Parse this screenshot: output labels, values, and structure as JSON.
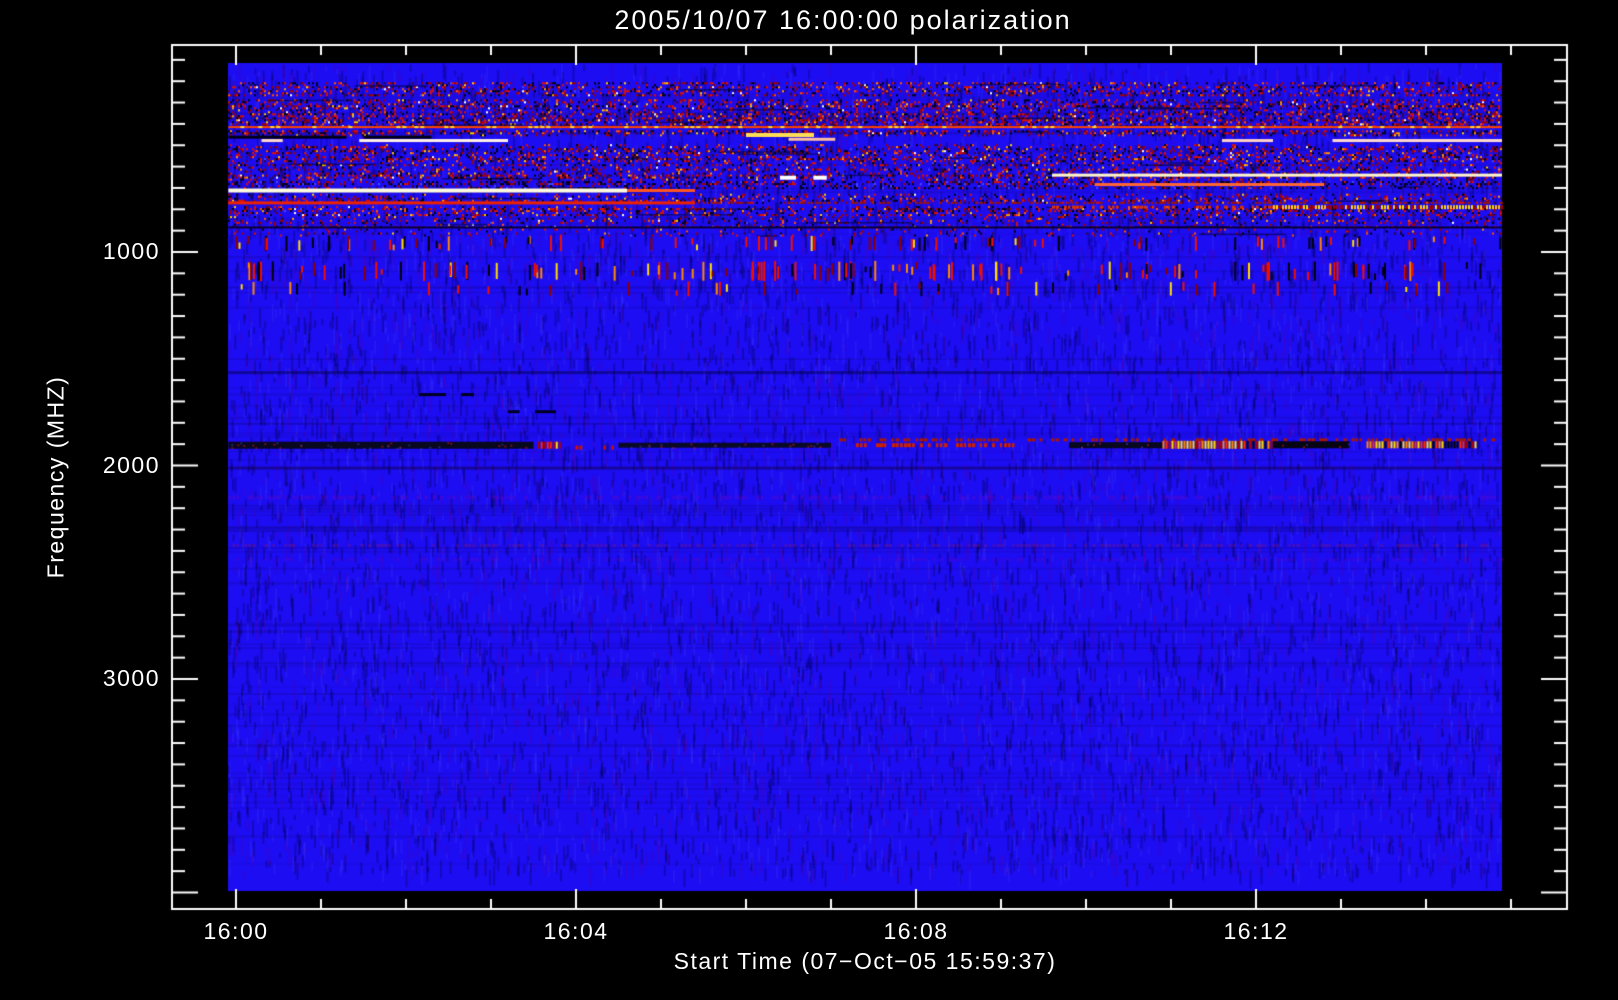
{
  "window": {
    "background": "#000000",
    "axis_color": "#ffffff"
  },
  "chart_data": {
    "type": "heatmap",
    "subtype": "radio-spectrogram",
    "title": "2005/10/07 16:00:00 polarization",
    "xlabel": "Start Time (07−Oct−05 15:59:37)",
    "ylabel": "Frequency (MHZ)",
    "legend": "none",
    "grid": "off",
    "x_axis": {
      "tick_labels": [
        "16:00",
        "16:04",
        "16:08",
        "16:12"
      ],
      "tick_minutes": [
        0,
        4,
        8,
        12
      ],
      "minor_step_min": 1,
      "axis_range_min": [
        -0.75,
        15.66
      ],
      "data_range_min": [
        -0.09,
        14.9
      ]
    },
    "y_axis": {
      "tick_labels": [
        "1000",
        "2000",
        "3000"
      ],
      "tick_mhz": [
        1000,
        2000,
        3000
      ],
      "minor_step_mhz": 100,
      "axis_range_mhz": [
        30,
        4080
      ],
      "data_range_mhz": [
        115,
        3995
      ],
      "direction": "increasing-downward"
    },
    "colors": {
      "base": "#1d0df2",
      "axis": "#ffffff",
      "speckle": [
        "#a00000",
        "#e01000",
        "#000018",
        "#2e083a",
        "#ff5500",
        "#5a0030",
        "#ff9900",
        "#ffd000",
        "#ffffff",
        "#4545ff"
      ],
      "rfi": [
        "#ee1100",
        "#8a0000",
        "#000010",
        "#ffdd00",
        "#ff8800"
      ]
    },
    "noise_bands": [
      {
        "f0": 205,
        "f1": 265,
        "d": 0.4,
        "dark": false
      },
      {
        "f0": 285,
        "f1": 410,
        "d": 0.5,
        "dark": false
      },
      {
        "f0": 430,
        "f1": 458,
        "d": 0.45,
        "dark": false
      },
      {
        "f0": 495,
        "f1": 595,
        "d": 0.4,
        "dark": false
      },
      {
        "f0": 600,
        "f1": 662,
        "d": 0.45,
        "dark": false
      },
      {
        "f0": 668,
        "f1": 700,
        "d": 0.45,
        "dark": true
      },
      {
        "f0": 727,
        "f1": 770,
        "d": 0.3,
        "dark": false
      },
      {
        "f0": 785,
        "f1": 835,
        "d": 0.4,
        "dark": false
      },
      {
        "f0": 840,
        "f1": 885,
        "d": 0.2,
        "dark": false
      },
      {
        "f0": 890,
        "f1": 925,
        "d": 0.1,
        "dark": false
      }
    ],
    "rfi_bands": [
      {
        "f0": 925,
        "f1": 995,
        "d": 0.3
      },
      {
        "f0": 1045,
        "f1": 1135,
        "d": 0.45
      },
      {
        "f0": 1140,
        "f1": 1205,
        "d": 0.15
      }
    ],
    "line_features": [
      {
        "f": 415,
        "t0": -0.09,
        "t1": 14.9,
        "c": "#ff4400",
        "h": 2,
        "s": "hotline"
      },
      {
        "f": 462,
        "t0": -0.09,
        "t1": 1.3,
        "c": "#000014",
        "h": 3,
        "s": "solid"
      },
      {
        "f": 462,
        "t0": 1.5,
        "t1": 2.3,
        "c": "#000014",
        "h": 3,
        "s": "solid"
      },
      {
        "f": 478,
        "t0": 0.3,
        "t1": 0.55,
        "c": "#ffd8c8",
        "h": 3,
        "s": "solid"
      },
      {
        "f": 478,
        "t0": 1.45,
        "t1": 3.2,
        "c": "#fff0e6",
        "h": 3,
        "s": "solid"
      },
      {
        "f": 452,
        "t0": 6.0,
        "t1": 6.8,
        "c": "#ffdd55",
        "h": 4,
        "s": "solid"
      },
      {
        "f": 472,
        "t0": 6.5,
        "t1": 7.05,
        "c": "#ffc0a0",
        "h": 3,
        "s": "solid"
      },
      {
        "f": 478,
        "t0": 11.6,
        "t1": 12.2,
        "c": "#ffd0c4",
        "h": 3,
        "s": "solid"
      },
      {
        "f": 478,
        "t0": 12.9,
        "t1": 14.9,
        "c": "#ffd8cc",
        "h": 3,
        "s": "solid"
      },
      {
        "f": 652,
        "t0": 6.4,
        "t1": 6.95,
        "c": "#ffffff",
        "h": 4,
        "s": "dashes"
      },
      {
        "f": 712,
        "t0": -0.09,
        "t1": 4.6,
        "c": "#fffbdd",
        "h": 4,
        "s": "solid"
      },
      {
        "f": 712,
        "t0": 4.6,
        "t1": 5.4,
        "c": "#ff5522",
        "h": 3,
        "s": "solid"
      },
      {
        "f": 640,
        "t0": 9.6,
        "t1": 14.9,
        "c": "#fff6cc",
        "h": 3,
        "s": "solid"
      },
      {
        "f": 684,
        "t0": 10.1,
        "t1": 12.8,
        "c": "#ff6633",
        "h": 3,
        "s": "solid"
      },
      {
        "f": 770,
        "t0": -0.09,
        "t1": 5.4,
        "c": "#ee2200",
        "h": 3,
        "s": "solid"
      },
      {
        "f": 770,
        "t0": 5.4,
        "t1": 14.9,
        "c": "#99150a",
        "h": 2,
        "s": "dotted"
      },
      {
        "f": 790,
        "t0": 9.6,
        "t1": 12.2,
        "c": "#dd3300",
        "h": 3,
        "s": "dotted"
      },
      {
        "f": 790,
        "t0": 12.2,
        "t1": 14.9,
        "c": "#ffbb33",
        "h": 4,
        "s": "stripes"
      },
      {
        "f": 885,
        "t0": -0.09,
        "t1": 14.9,
        "c": "#0d0030",
        "h": 2,
        "s": "solid"
      },
      {
        "f": 1565,
        "t0": -0.09,
        "t1": 14.9,
        "c": "rgba(0,0,50,0.45)",
        "h": 3,
        "s": "solid"
      },
      {
        "f": 1668,
        "t0": 2.15,
        "t1": 2.8,
        "c": "#000020",
        "h": 3,
        "s": "dashes"
      },
      {
        "f": 1748,
        "t0": 3.2,
        "t1": 3.85,
        "c": "#000020",
        "h": 3,
        "s": "dashes"
      },
      {
        "f": 1880,
        "t0": 7.1,
        "t1": 14.9,
        "c": "#aa1700",
        "h": 3,
        "s": "dotted"
      },
      {
        "f": 1905,
        "t0": -0.09,
        "t1": 3.5,
        "c": "#08081e",
        "h": 7,
        "s": "mottle"
      },
      {
        "f": 1905,
        "t0": 3.55,
        "t1": 3.8,
        "c": "#ff2200",
        "h": 7,
        "s": "stripes"
      },
      {
        "f": 1916,
        "t0": 3.9,
        "t1": 4.5,
        "c": "#cc1100",
        "h": 4,
        "s": "dotted"
      },
      {
        "f": 1905,
        "t0": 4.5,
        "t1": 7.0,
        "c": "#0a0a26",
        "h": 5,
        "s": "mottle"
      },
      {
        "f": 1905,
        "t0": 7.2,
        "t1": 9.2,
        "c": "#cc2200",
        "h": 4,
        "s": "dotted"
      },
      {
        "f": 1905,
        "t0": 9.8,
        "t1": 10.9,
        "c": "#08081e",
        "h": 6,
        "s": "mottle"
      },
      {
        "f": 1903,
        "t0": 10.9,
        "t1": 12.2,
        "c": "#ff3300",
        "h": 8,
        "s": "fire"
      },
      {
        "f": 1903,
        "t0": 12.2,
        "t1": 13.1,
        "c": "#050514",
        "h": 7,
        "s": "mottle"
      },
      {
        "f": 1903,
        "t0": 13.3,
        "t1": 14.6,
        "c": "#ff4400",
        "h": 7,
        "s": "fire"
      },
      {
        "f": 2012,
        "t0": -0.09,
        "t1": 14.9,
        "c": "rgba(20,0,70,0.5)",
        "h": 3,
        "s": "solid"
      },
      {
        "f": 2150,
        "t0": -0.09,
        "t1": 14.9,
        "c": "rgba(160,0,160,0.22)",
        "h": 4,
        "s": "dotted"
      },
      {
        "f": 2375,
        "t0": -0.09,
        "t1": 14.9,
        "c": "rgba(170,30,60,0.28)",
        "h": 3,
        "s": "dotted"
      },
      {
        "f": 2440,
        "t0": -0.09,
        "t1": 14.9,
        "c": "rgba(130,0,170,0.22)",
        "h": 3,
        "s": "dotted"
      }
    ]
  }
}
